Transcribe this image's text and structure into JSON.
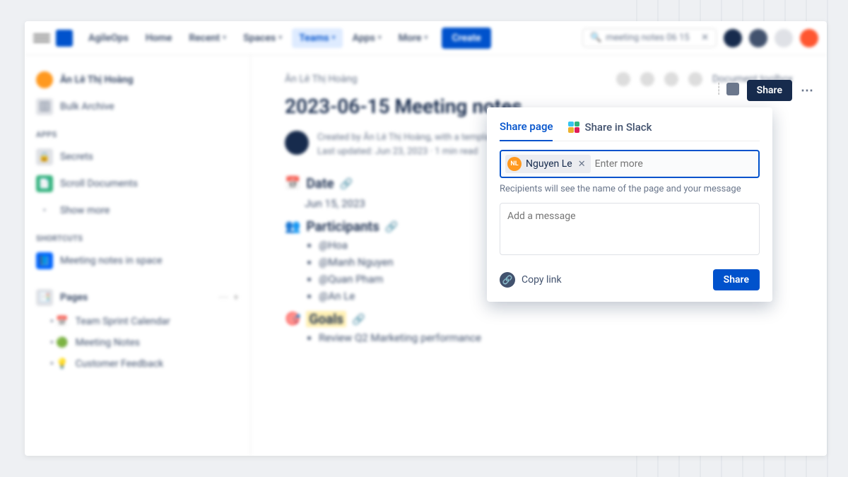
{
  "nav": {
    "brand": "AgileOps",
    "items": [
      "Home",
      "Recent",
      "Spaces",
      "Teams",
      "Apps",
      "More"
    ],
    "active_index": 3,
    "create": "Create",
    "search": "meeting notes 06 15"
  },
  "sidebar": {
    "user": "Ân Lê Thị Hoàng",
    "bulk": "Bulk Archive",
    "sections": {
      "apps_label": "APPS",
      "apps": [
        "Secrets",
        "Scroll Documents",
        "Show more"
      ],
      "shortcuts_label": "SHORTCUTS",
      "shortcuts": [
        "Meeting notes in space"
      ],
      "pages_label": "Pages",
      "pages": [
        "Team Sprint Calendar",
        "Meeting Notes",
        "Customer Feedback"
      ]
    }
  },
  "page": {
    "breadcrumb": "Ân Lê Thị Hoàng",
    "toolbox": "Document toolbox",
    "title": "2023-06-15 Meeting notes",
    "byline1": "Created by Ân Lê Thị Hoàng, with a template",
    "byline2": "Last updated: Jun 23, 2023 · 1 min read",
    "date_label": "Date",
    "date_value": "Jun 15, 2023",
    "participants_label": "Participants",
    "participants": [
      "@Hoa",
      "@Manh Nguyen",
      "@Quan Pham",
      "@An Le"
    ],
    "goals_label": "Goals",
    "goals": [
      "Review Q2 Marketing performance"
    ]
  },
  "share": {
    "open_button": "Share",
    "tabs": {
      "share_page": "Share page",
      "share_slack": "Share in Slack"
    },
    "chip": {
      "initials": "NL",
      "name": "Nguyen Le"
    },
    "recipients_placeholder": "Enter more",
    "helper": "Recipients will see the name of the page and your message",
    "message_placeholder": "Add a message",
    "copy_link": "Copy link",
    "submit": "Share"
  }
}
